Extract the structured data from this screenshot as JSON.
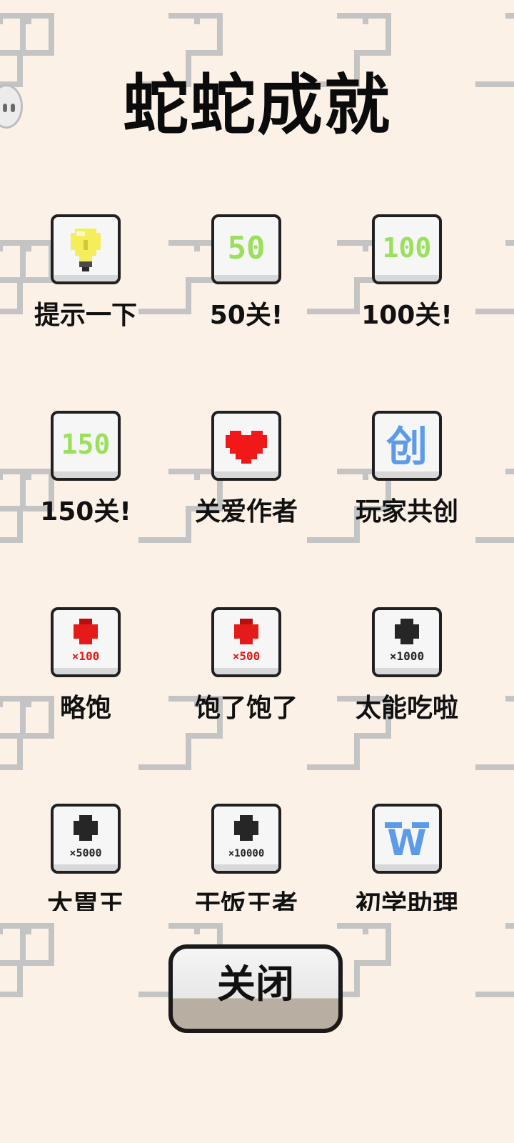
{
  "page": {
    "title": "蛇蛇成就"
  },
  "achievements": [
    {
      "label": "提示一下",
      "icon": "lightbulb-icon"
    },
    {
      "label": "50关!",
      "icon": "level-50-icon",
      "icon_text": "50"
    },
    {
      "label": "100关!",
      "icon": "level-100-icon",
      "icon_text": "100"
    },
    {
      "label": "150关!",
      "icon": "level-150-icon",
      "icon_text": "150"
    },
    {
      "label": "关爱作者",
      "icon": "heart-icon"
    },
    {
      "label": "玩家共创",
      "icon": "create-icon",
      "icon_text": "创"
    },
    {
      "label": "略饱",
      "icon": "red-fruit-icon",
      "icon_text": "×100"
    },
    {
      "label": "饱了饱了",
      "icon": "red-fruit-icon",
      "icon_text": "×500"
    },
    {
      "label": "太能吃啦",
      "icon": "black-fruit-icon",
      "icon_text": "×1000"
    },
    {
      "label": "大胃王",
      "icon": "black-fruit-icon",
      "icon_text": "×5000"
    },
    {
      "label": "干饭王者",
      "icon": "black-fruit-icon",
      "icon_text": "×10000"
    },
    {
      "label": "初学助理",
      "icon": "w-icon",
      "icon_text": "W"
    }
  ],
  "close_button": {
    "label": "关闭"
  },
  "colors": {
    "background": "#FCF1E7",
    "snake_pattern": "#C4C4C4",
    "level_green": "#9BE05C",
    "heart_red": "#F01818",
    "create_blue": "#5B9BE8",
    "fruit_red": "#E51A1A",
    "fruit_black": "#262626"
  }
}
